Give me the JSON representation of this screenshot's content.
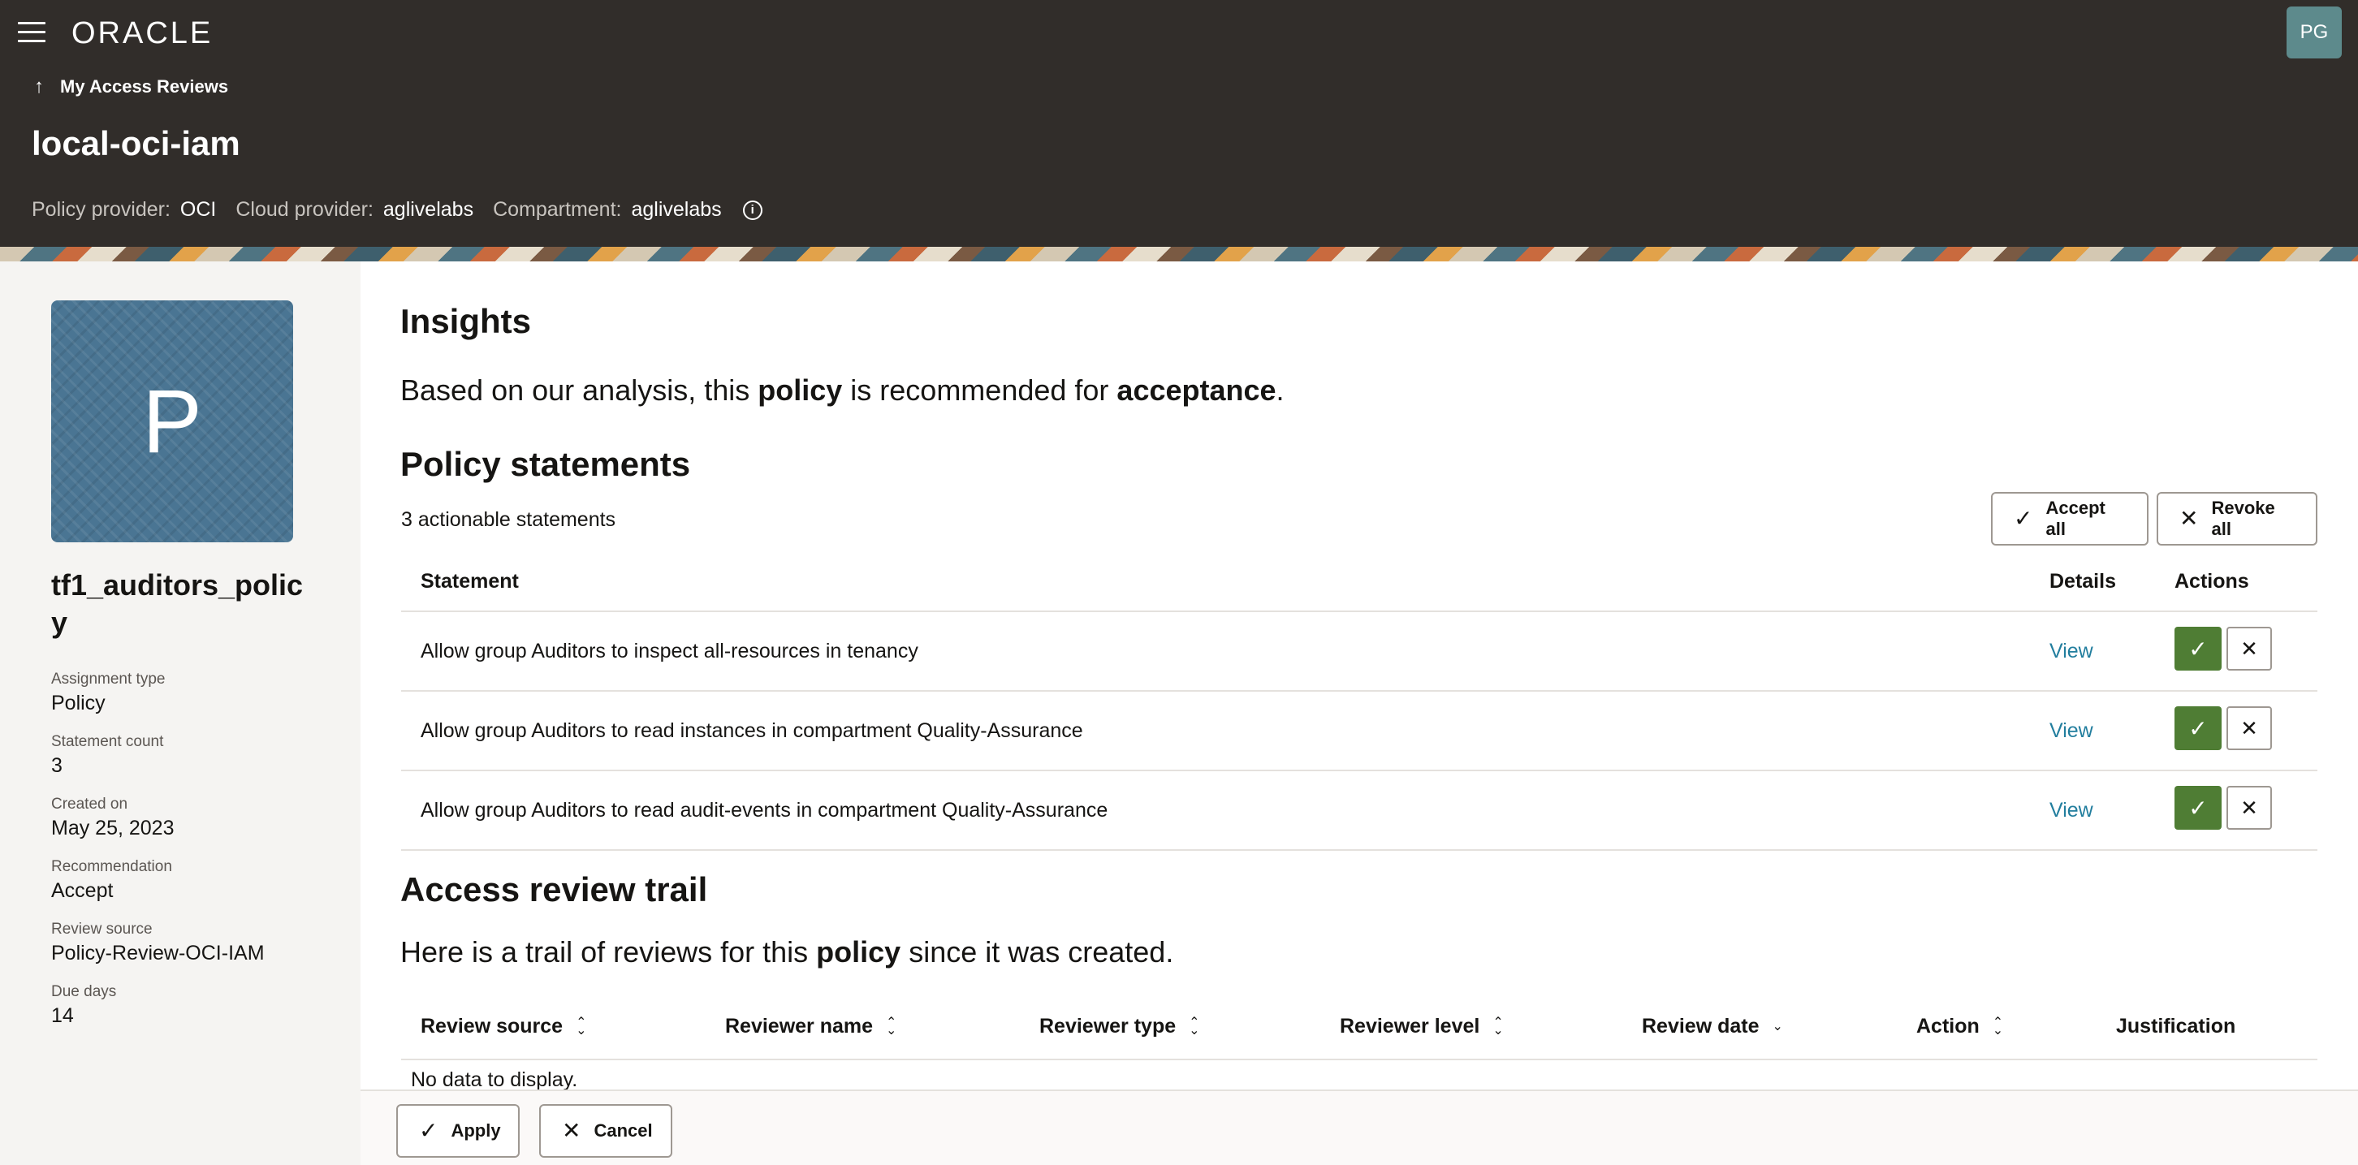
{
  "header": {
    "menu_icon": "hamburger-icon",
    "logo_text": "ORACLE",
    "user_initials": "PG",
    "back_label": "My Access Reviews",
    "back_icon": "arrow-up-icon",
    "title": "local-oci-iam",
    "meta": {
      "policy_provider_label": "Policy provider:",
      "policy_provider_value": "OCI",
      "cloud_provider_label": "Cloud provider:",
      "cloud_provider_value": "aglivelabs",
      "compartment_label": "Compartment:",
      "compartment_value": "aglivelabs",
      "info_icon": "info-icon"
    }
  },
  "sidebar": {
    "avatar_letter": "P",
    "policy_name": "tf1_auditors_policy",
    "fields": [
      {
        "label": "Assignment type",
        "value": "Policy"
      },
      {
        "label": "Statement count",
        "value": "3"
      },
      {
        "label": "Created on",
        "value": "May 25, 2023"
      },
      {
        "label": "Recommendation",
        "value": "Accept"
      },
      {
        "label": "Review source",
        "value": "Policy-Review-OCI-IAM"
      },
      {
        "label": "Due days",
        "value": "14"
      }
    ]
  },
  "insights": {
    "title": "Insights",
    "text_pre": "Based on our analysis, this ",
    "text_bold1": "policy",
    "text_mid": " is recommended for ",
    "text_bold2": "acceptance",
    "text_post": "."
  },
  "policy_statements": {
    "title": "Policy statements",
    "count_text": "3 actionable statements",
    "accept_all_label": "Accept all",
    "revoke_all_label": "Revoke all",
    "columns": {
      "statement": "Statement",
      "details": "Details",
      "actions": "Actions"
    },
    "rows": [
      {
        "statement": "Allow group Auditors to inspect all-resources in tenancy",
        "details": "View"
      },
      {
        "statement": "Allow group Auditors to read instances in compartment Quality-Assurance",
        "details": "View"
      },
      {
        "statement": "Allow group Auditors to read audit-events in compartment Quality-Assurance",
        "details": "View"
      }
    ]
  },
  "trail": {
    "title": "Access review trail",
    "text_pre": "Here is a trail of reviews for this ",
    "text_bold": "policy",
    "text_post": " since it was created.",
    "columns": {
      "review_source": "Review source",
      "reviewer_name": "Reviewer name",
      "reviewer_type": "Reviewer type",
      "reviewer_level": "Reviewer level",
      "review_date": "Review date",
      "action": "Action",
      "justification": "Justification"
    },
    "empty_text": "No data to display."
  },
  "footer": {
    "apply_label": "Apply",
    "cancel_label": "Cancel"
  },
  "colors": {
    "header_bg": "#312d2a",
    "accept_green": "#4f7d34",
    "link_blue": "#227e9e",
    "sidebar_bg": "#f5f4f2"
  }
}
